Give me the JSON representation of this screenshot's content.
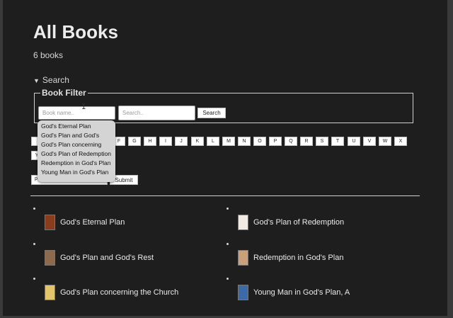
{
  "page": {
    "title": "All Books",
    "count": "6 books"
  },
  "search": {
    "toggle_label": "Search",
    "legend": "Book Filter",
    "book_name_placeholder": "Book name..",
    "query_placeholder": "Search..",
    "search_button": "Search",
    "submit_button": "Submit",
    "bottom_input_value": "p"
  },
  "autocomplete": [
    "God's Eternal Plan",
    "God's Plan and God's",
    "God's Plan concerning",
    "God's Plan of Redemption",
    "Redemption in God's Plan",
    "Young Man in God's Plan"
  ],
  "letters_row1_visible": [
    "F",
    "G",
    "H",
    "I",
    "J",
    "K",
    "L",
    "M",
    "N",
    "O",
    "P",
    "Q",
    "R",
    "S",
    "T",
    "U",
    "V",
    "W",
    "X"
  ],
  "books": [
    {
      "title": "God's Eternal Plan",
      "cover_color": "#8a3d1c"
    },
    {
      "title": "God's Plan of Redemption",
      "cover_color": "#f1e9e2"
    },
    {
      "title": "God's Plan and God's Rest",
      "cover_color": "#8c6a4b"
    },
    {
      "title": "Redemption in God's Plan",
      "cover_color": "#c9a07a"
    },
    {
      "title": "God's Plan concerning the Church",
      "cover_color": "#e2c46c"
    },
    {
      "title": "Young Man in God's Plan, A",
      "cover_color": "#3c6aa8"
    }
  ]
}
